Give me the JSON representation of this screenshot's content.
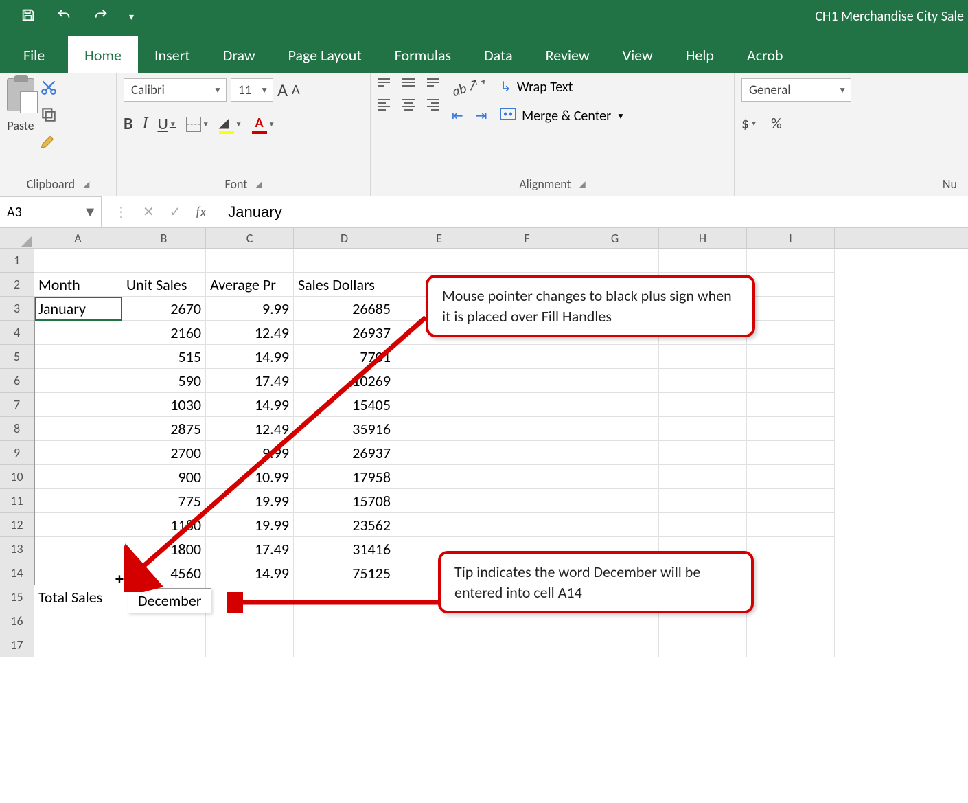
{
  "app": {
    "title": "CH1 Merchandise City Sale"
  },
  "qat": {
    "save": "save-icon",
    "undo": "undo-icon",
    "redo": "redo-icon",
    "custom": "▾"
  },
  "tabs": {
    "file": "File",
    "home": "Home",
    "insert": "Insert",
    "draw": "Draw",
    "pageLayout": "Page Layout",
    "formulas": "Formulas",
    "data": "Data",
    "review": "Review",
    "view": "View",
    "help": "Help",
    "acrobat": "Acrob"
  },
  "ribbon": {
    "clipboard": {
      "paste": "Paste",
      "label": "Clipboard"
    },
    "font": {
      "name": "Calibri",
      "size": "11",
      "grow": "A",
      "shrink": "A",
      "bold": "B",
      "italic": "I",
      "underline": "U",
      "fontColorLetter": "A",
      "label": "Font"
    },
    "alignment": {
      "orient": "ab",
      "wrap": "Wrap Text",
      "merge": "Merge & Center",
      "label": "Alignment"
    },
    "number": {
      "format": "General",
      "currency": "$",
      "percent": "%",
      "label": "Nu"
    }
  },
  "fbar": {
    "cellRef": "A3",
    "fx": "fx",
    "value": "January"
  },
  "columns": [
    "A",
    "B",
    "C",
    "D",
    "E",
    "F",
    "G",
    "H",
    "I"
  ],
  "rowNums": [
    "1",
    "2",
    "3",
    "4",
    "5",
    "6",
    "7",
    "8",
    "9",
    "10",
    "11",
    "12",
    "13",
    "14",
    "15",
    "16",
    "17"
  ],
  "sheet": {
    "headers": {
      "a": "Month",
      "b": "Unit Sales",
      "c": "Average Pr",
      "d": "Sales Dollars"
    },
    "a3": "January",
    "data": [
      {
        "b": "2670",
        "c": "9.99",
        "d": "26685"
      },
      {
        "b": "2160",
        "c": "12.49",
        "d": "26937"
      },
      {
        "b": "515",
        "c": "14.99",
        "d": "7701"
      },
      {
        "b": "590",
        "c": "17.49",
        "d": "10269"
      },
      {
        "b": "1030",
        "c": "14.99",
        "d": "15405"
      },
      {
        "b": "2875",
        "c": "12.49",
        "d": "35916"
      },
      {
        "b": "2700",
        "c": "9.99",
        "d": "26937"
      },
      {
        "b": "900",
        "c": "10.99",
        "d": "17958"
      },
      {
        "b": "775",
        "c": "19.99",
        "d": "15708"
      },
      {
        "b": "1180",
        "c": "19.99",
        "d": "23562"
      },
      {
        "b": "1800",
        "c": "17.49",
        "d": "31416"
      },
      {
        "b": "4560",
        "c": "14.99",
        "d": "75125"
      }
    ],
    "a15": "Total Sales"
  },
  "fillTip": "December",
  "callouts": {
    "c1": "Mouse pointer changes to black plus sign when it is placed over Fill Handles",
    "c2": "Tip indicates the word December will be entered into cell A14"
  }
}
